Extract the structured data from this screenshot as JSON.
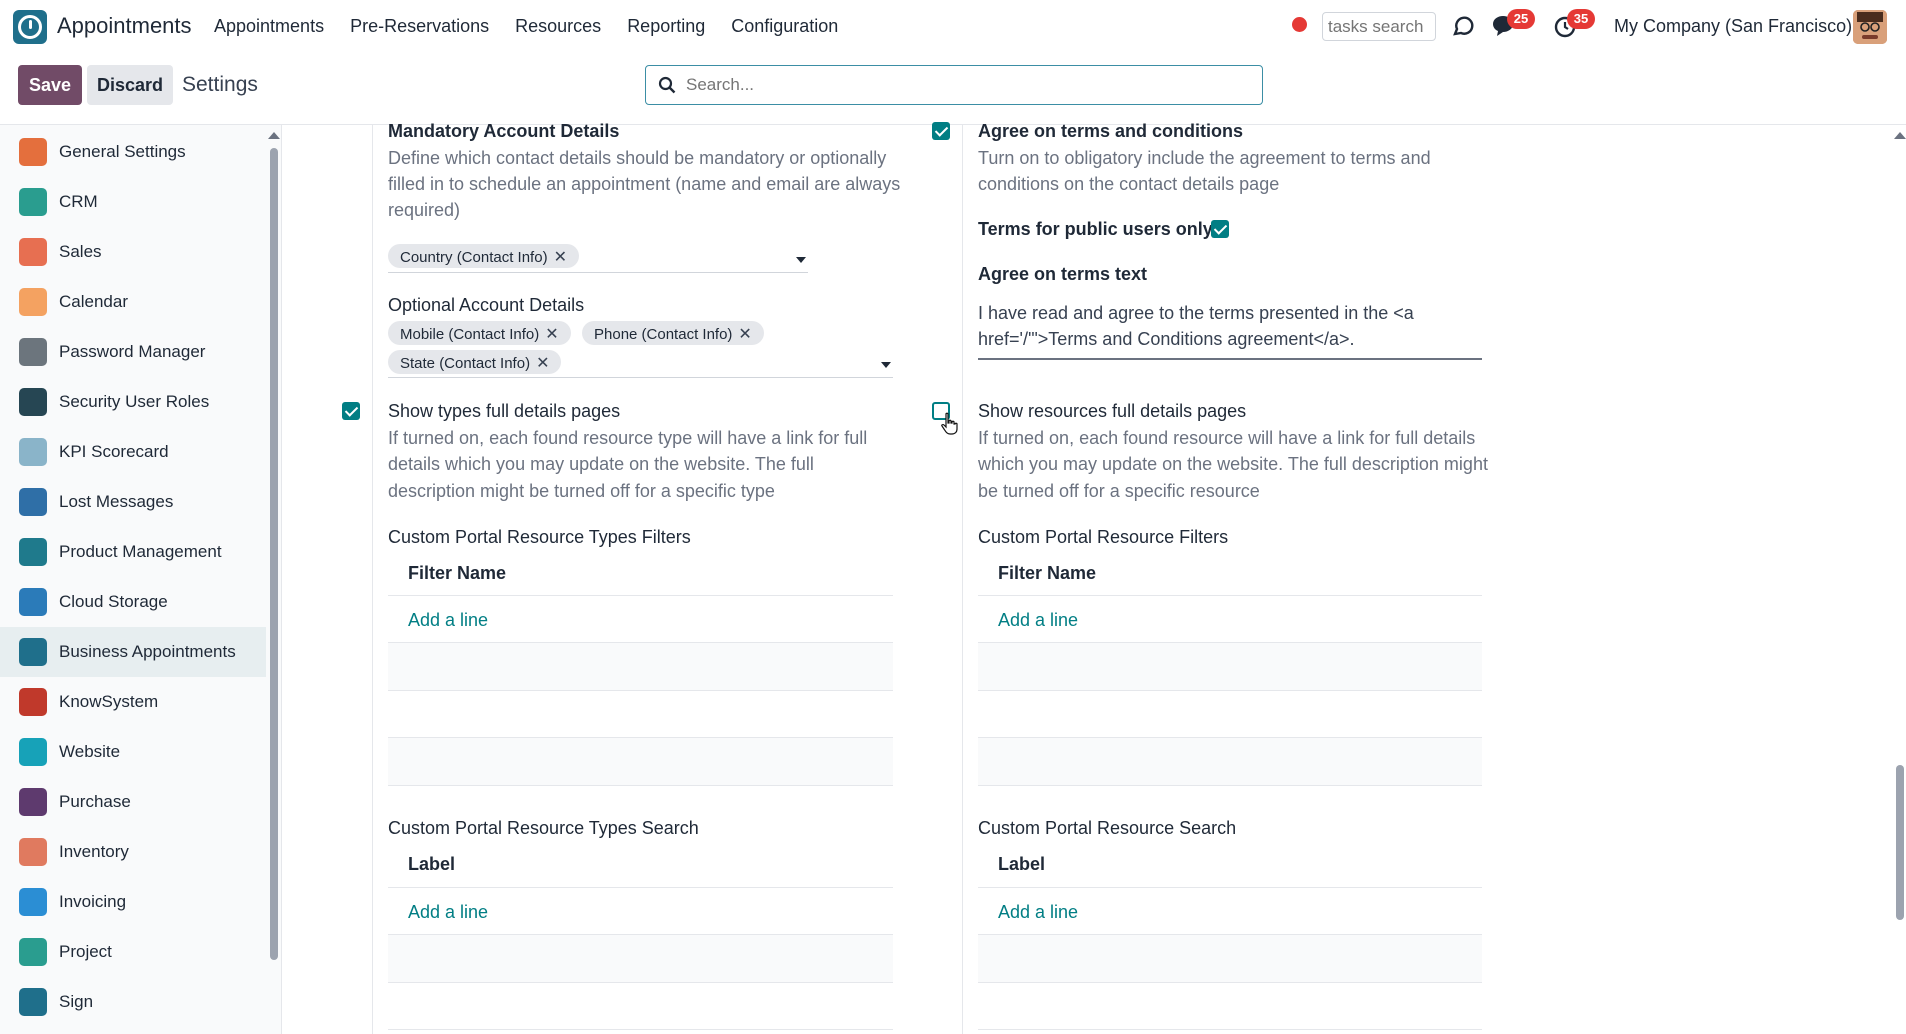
{
  "navbar": {
    "app_name": "Appointments",
    "menu": [
      "Appointments",
      "Pre-Reservations",
      "Resources",
      "Reporting",
      "Configuration"
    ],
    "tasks_search_placeholder": "tasks search",
    "messages_badge": "25",
    "activities_badge": "35",
    "company": "My Company (San Francisco)"
  },
  "control": {
    "save_label": "Save",
    "discard_label": "Discard",
    "title": "Settings",
    "search_placeholder": "Search..."
  },
  "sidebar": {
    "items": [
      {
        "label": "General Settings",
        "icon": "general-settings-icon",
        "color": "#e46f3d"
      },
      {
        "label": "CRM",
        "icon": "crm-icon",
        "color": "#2a9d8f"
      },
      {
        "label": "Sales",
        "icon": "sales-icon",
        "color": "#e76f51"
      },
      {
        "label": "Calendar",
        "icon": "calendar-icon",
        "color": "#f4a261"
      },
      {
        "label": "Password Manager",
        "icon": "password-manager-icon",
        "color": "#6c757d"
      },
      {
        "label": "Security User Roles",
        "icon": "security-user-roles-icon",
        "color": "#264653"
      },
      {
        "label": "KPI Scorecard",
        "icon": "kpi-scorecard-icon",
        "color": "#8ab4c9"
      },
      {
        "label": "Lost Messages",
        "icon": "lost-messages-icon",
        "color": "#2f6fa7"
      },
      {
        "label": "Product Management",
        "icon": "product-management-icon",
        "color": "#1f7a8c"
      },
      {
        "label": "Cloud Storage",
        "icon": "cloud-storage-icon",
        "color": "#2b7bb9"
      },
      {
        "label": "Business Appointments",
        "icon": "business-appointments-icon",
        "color": "#1f6f8b"
      },
      {
        "label": "KnowSystem",
        "icon": "knowsystem-icon",
        "color": "#c0392b"
      },
      {
        "label": "Website",
        "icon": "website-icon",
        "color": "#17a2b8"
      },
      {
        "label": "Purchase",
        "icon": "purchase-icon",
        "color": "#5e3a6e"
      },
      {
        "label": "Inventory",
        "icon": "inventory-icon",
        "color": "#e07a5f"
      },
      {
        "label": "Invoicing",
        "icon": "invoicing-icon",
        "color": "#2b8ed4"
      },
      {
        "label": "Project",
        "icon": "project-icon",
        "color": "#2a9d8f"
      },
      {
        "label": "Sign",
        "icon": "sign-icon",
        "color": "#1f6f8b"
      }
    ]
  },
  "left_col": {
    "mandatory_title": "Mandatory Account Details",
    "mandatory_desc_1": "Define which contact details should be mandatory or optionally",
    "mandatory_desc_2": "filled in to schedule an appointment (name and email are always",
    "mandatory_desc_3": "required)",
    "mandatory_tag": "Country (Contact Info)",
    "optional_title": "Optional Account Details",
    "optional_tags": [
      "Mobile (Contact Info)",
      "Phone (Contact Info)",
      "State (Contact Info)"
    ],
    "types_title": "Show types full details pages",
    "types_desc_1": "If turned on, each found resource type will have a link for full",
    "types_desc_2": "details which you may update on the website. The full",
    "types_desc_3": "description might be turned off for a specific type",
    "types_filters_title": "Custom Portal Resource Types Filters",
    "filter_col": "Filter Name",
    "add_line": "Add a line",
    "types_search_title": "Custom Portal Resource Types Search",
    "label_col": "Label"
  },
  "right_col": {
    "terms_title": "Agree on terms and conditions",
    "terms_desc_1": "Turn on to obligatory include the agreement to terms and",
    "terms_desc_2": "conditions on the contact details page",
    "public_label": "Terms for public users only",
    "terms_text_label": "Agree on terms text",
    "terms_text_1": "I have read and agree to the terms presented in the <a",
    "terms_text_2": "href='/'\">Terms and Conditions agreement</a>.",
    "resources_title": "Show resources full details pages",
    "resources_desc_1": "If turned on, each found resource will have a link for full details",
    "resources_desc_2": "which you may update on the website. The full description might",
    "resources_desc_3": "be turned off for a specific resource",
    "resources_filters_title": "Custom Portal Resource Filters",
    "filter_col": "Filter Name",
    "add_line": "Add a line",
    "resources_search_title": "Custom Portal Resource Search",
    "label_col": "Label"
  },
  "colors": {
    "primary": "#714b67",
    "accent": "#017e84",
    "badge": "#e53935"
  }
}
